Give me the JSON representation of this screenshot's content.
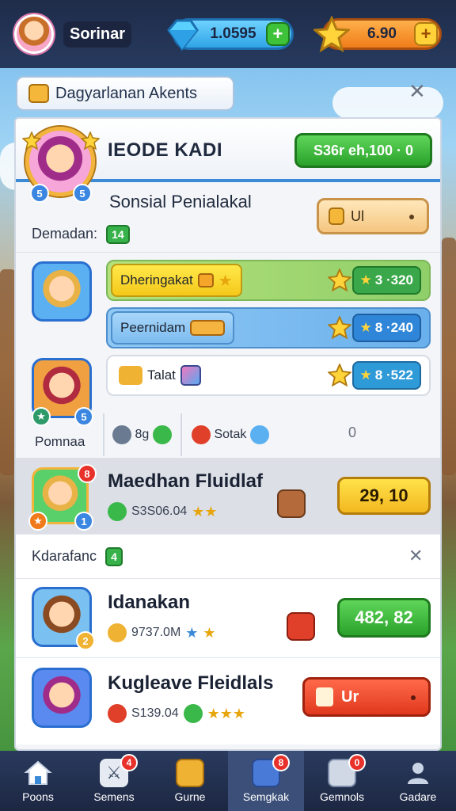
{
  "hud": {
    "player_name": "Sorinar",
    "gems_value": "1.0595",
    "coins_value": "6.90"
  },
  "panel": {
    "title": "Dagyarlanan Akents",
    "header_title": "IEODE KADI",
    "header_button": "S36r eh,100 · 0",
    "portrait_level_left": "5",
    "portrait_level_right": "5",
    "section_title": "Sonsial Penialakal",
    "section_label": "Demadan:",
    "section_badge": "14",
    "orange_pill_label": "Ul",
    "tasks": [
      {
        "label": "Dheringakat",
        "reward": "3 ·320"
      },
      {
        "label": "Peernidam",
        "reward": "8 ·240"
      },
      {
        "label": "Talat",
        "reward": "8 ·522"
      }
    ],
    "portrait_caption": "Pomnaa",
    "status_items": [
      {
        "label": "8g"
      },
      {
        "label": "Sotak"
      },
      {
        "label": "0"
      }
    ],
    "featured": {
      "name": "Maedhan Fluidlaf",
      "meta": "S3S06.04",
      "badge": "8",
      "button": "29, 10"
    },
    "second_section_label": "Kdarafanc",
    "second_section_badge": "4",
    "entries": [
      {
        "name": "Idanakan",
        "meta": "9737.0M",
        "badge": "2",
        "button": "482, 82"
      },
      {
        "name": "Kugleave Fleidlals",
        "meta": "S139.04",
        "button": "Ur"
      }
    ]
  },
  "nav": [
    {
      "label": "Poons",
      "icon": "home-icon"
    },
    {
      "label": "Semens",
      "icon": "sword-icon",
      "badge": "4"
    },
    {
      "label": "Gurne",
      "icon": "chest-icon"
    },
    {
      "label": "Semgkak",
      "icon": "card-icon",
      "badge": "8"
    },
    {
      "label": "Gemnols",
      "icon": "robot-icon",
      "badge": "0"
    },
    {
      "label": "Gadare",
      "icon": "profile-icon"
    }
  ],
  "colors": {
    "accent_blue": "#3a8ad8",
    "green_button": "#2aa12a",
    "yellow_button": "#f3b820",
    "red_button": "#e0381e",
    "nav_bg": "#1c2742"
  }
}
